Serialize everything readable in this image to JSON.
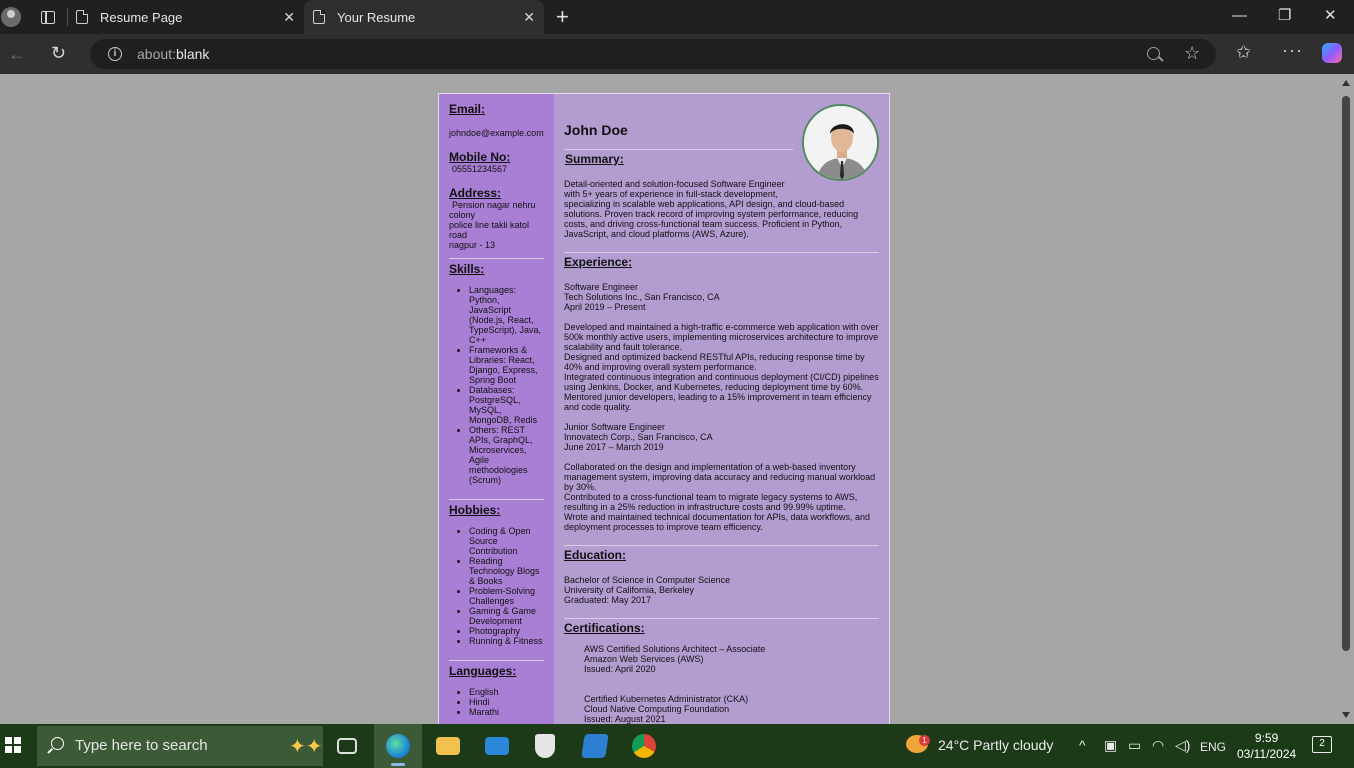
{
  "browser": {
    "tabs": [
      {
        "label": "Resume Page",
        "active": false
      },
      {
        "label": "Your Resume",
        "active": true
      }
    ],
    "address": {
      "scheme": "about:",
      "path": "blank"
    }
  },
  "resume": {
    "sidebar": {
      "email_heading": "Email:",
      "email": "johndoe@example.com",
      "mobile_heading": "Mobile No:",
      "mobile": "05551234567",
      "address_heading": "Address:",
      "address_lines": [
        "Pension nagar nehru",
        "colony",
        "police line takli katol",
        "road",
        "nagpur - 13"
      ],
      "skills_heading": "Skills:",
      "skills": [
        [
          "Languages:",
          "Python,",
          "JavaScript",
          "(Node.js, React,",
          "TypeScript), Java,",
          "C++"
        ],
        [
          "Frameworks &",
          "Libraries: React,",
          "Django, Express,",
          "Spring Boot"
        ],
        [
          "Databases:",
          "PostgreSQL,",
          "MySQL,",
          "MongoDB, Redis"
        ],
        [
          "Others: REST",
          "APIs, GraphQL,",
          "Microservices,",
          "Agile",
          "methodologies",
          "(Scrum)"
        ]
      ],
      "hobbies_heading": "Hobbies:",
      "hobbies": [
        [
          "Coding & Open",
          "Source",
          "Contribution"
        ],
        [
          "Reading",
          "Technology Blogs",
          "& Books"
        ],
        [
          "Problem-Solving",
          "Challenges"
        ],
        [
          "Gaming & Game",
          "Development"
        ],
        [
          "Photography"
        ],
        [
          "Running & Fitness"
        ]
      ],
      "languages_heading": "Languages:",
      "languages": [
        "English",
        "Hindi",
        "Marathi"
      ]
    },
    "main": {
      "name": "John Doe",
      "summary_heading": "Summary:",
      "summary_lines": [
        "Detail-oriented and solution-focused Software Engineer",
        "with 5+ years of experience in full-stack development,",
        "specializing in scalable web applications, API design, and cloud-based",
        "solutions. Proven track record of improving system performance, reducing",
        "costs, and driving cross-functional team success. Proficient in Python,",
        "JavaScript, and cloud platforms (AWS, Azure)."
      ],
      "experience_heading": "Experience:",
      "jobs": [
        {
          "header": [
            "Software Engineer",
            "Tech Solutions Inc., San Francisco, CA",
            "April 2019 – Present"
          ],
          "details": [
            "Developed and maintained a high-traffic e-commerce web application with over",
            "500k monthly active users, implementing microservices architecture to improve",
            "scalability and fault tolerance.",
            "Designed and optimized backend RESTful APIs, reducing response time by",
            "40% and improving overall system performance.",
            "Integrated continuous integration and continuous deployment (CI/CD) pipelines",
            "using Jenkins, Docker, and Kubernetes, reducing deployment time by 60%.",
            "Mentored junior developers, leading to a 15% improvement in team efficiency",
            "and code quality."
          ]
        },
        {
          "header": [
            "Junior Software Engineer",
            "Innovatech Corp., San Francisco, CA",
            "June 2017 – March 2019"
          ],
          "details": [
            "Collaborated on the design and implementation of a web-based inventory",
            "management system, improving data accuracy and reducing manual workload",
            "by 30%.",
            "Contributed to a cross-functional team to migrate legacy systems to AWS,",
            "resulting in a 25% reduction in infrastructure costs and 99.99% uptime.",
            "Wrote and maintained technical documentation for APIs, data workflows, and",
            "deployment processes to improve team efficiency."
          ]
        }
      ],
      "education_heading": "Education:",
      "education": [
        "Bachelor of Science in Computer Science",
        "University of California, Berkeley",
        "Graduated: May 2017"
      ],
      "certifications_heading": "Certifications:",
      "certifications": [
        [
          "AWS Certified Solutions Architect – Associate",
          "Amazon Web Services (AWS)",
          "Issued: April 2020"
        ],
        [
          "Certified Kubernetes Administrator (CKA)",
          "Cloud Native Computing Foundation",
          "Issued: August 2021"
        ]
      ]
    }
  },
  "taskbar": {
    "search_placeholder": "Type here to search",
    "weather_badge": "1",
    "weather": "24°C  Partly cloudy",
    "language": "ENG",
    "time": "9:59",
    "date": "03/11/2024",
    "notifications": "2"
  }
}
